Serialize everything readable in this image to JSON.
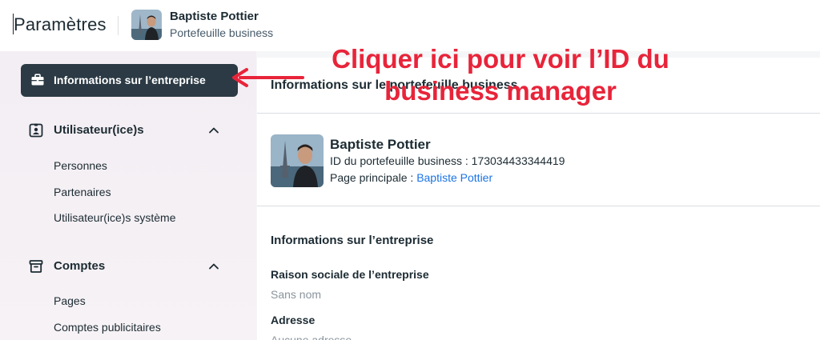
{
  "header": {
    "title": "Paramètres",
    "account_name": "Baptiste Pottier",
    "account_subtitle": "Portefeuille business"
  },
  "sidebar": {
    "active_item": {
      "label": "Informations sur l’entreprise",
      "icon": "briefcase-icon"
    },
    "sections": [
      {
        "label": "Utilisateur(ice)s",
        "icon": "user-badge-icon",
        "expanded": true,
        "items": [
          "Personnes",
          "Partenaires",
          "Utilisateur(ice)s système"
        ]
      },
      {
        "label": "Comptes",
        "icon": "archive-box-icon",
        "expanded": true,
        "items": [
          "Pages",
          "Comptes publicitaires"
        ]
      }
    ]
  },
  "main": {
    "title": "Informations sur le portefeuille business",
    "profile": {
      "name": "Baptiste Pottier",
      "id_label": "ID du portefeuille business : 173034433344419",
      "page_label": "Page principale : ",
      "page_link": "Baptiste Pottier"
    },
    "info_title": "Informations sur l’entreprise",
    "fields": [
      {
        "label": "Raison sociale de l’entreprise",
        "value": "Sans nom"
      },
      {
        "label": "Adresse",
        "value": "Aucune adresse"
      }
    ]
  },
  "annotation": {
    "line1": "Cliquer ici pour voir l’ID du",
    "line2": "business manager",
    "color": "#e8243a"
  },
  "colors": {
    "active_bg": "#2b3a44",
    "link": "#1b74e4",
    "sidebar_bg": "#f3eef3"
  }
}
